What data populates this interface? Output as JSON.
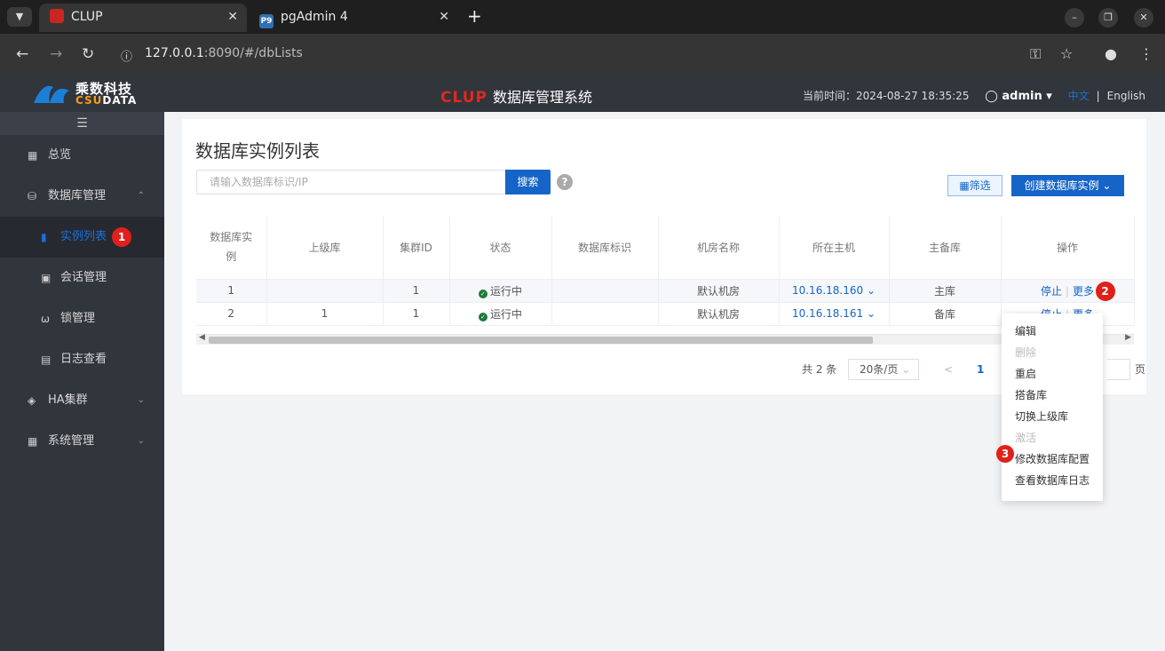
{
  "browser": {
    "tabs": [
      {
        "title": "CLUP",
        "active": true
      },
      {
        "title": "pgAdmin 4",
        "active": false
      }
    ],
    "url_host": "127.0.0.1",
    "url_rest": ":8090/#/dbLists",
    "pg_fav": "P9"
  },
  "header": {
    "logo_cn": "乘数科技",
    "logo_en_cs": "CSU",
    "logo_en_data": "DATA",
    "brand": "CLUP",
    "title": "数据库管理系统",
    "time": "当前时间：2024-08-27 18:35:25",
    "user": "admin",
    "lang_cn": "中文",
    "lang_sep": "|",
    "lang_en": "English"
  },
  "sidebar": {
    "items": [
      {
        "label": "总览"
      },
      {
        "label": "数据库管理"
      },
      {
        "label": "实例列表"
      },
      {
        "label": "会话管理"
      },
      {
        "label": "锁管理"
      },
      {
        "label": "日志查看"
      },
      {
        "label": "HA集群"
      },
      {
        "label": "系统管理"
      }
    ]
  },
  "main": {
    "title": "数据库实例列表",
    "search_placeholder": "请输入数据库标识/IP",
    "search_label": "搜索",
    "help": "?",
    "filter_label": "筛选",
    "create_label": "创建数据库实例",
    "columns": [
      "数据库实例",
      "上级库",
      "集群ID",
      "状态",
      "数据库标识",
      "机房名称",
      "所在主机",
      "主备库",
      "操作"
    ],
    "rows": [
      {
        "id": "1",
        "upper": "",
        "cluster": "1",
        "status": "运行中",
        "tag": "",
        "room": "默认机房",
        "host": "10.16.18.160",
        "role": "主库"
      },
      {
        "id": "2",
        "upper": "1",
        "cluster": "1",
        "status": "运行中",
        "tag": "",
        "room": "默认机房",
        "host": "10.16.18.161",
        "role": "备库"
      }
    ],
    "op_stop": "停止",
    "op_more": "更多",
    "total": "共 2 条",
    "page_size": "20条/页",
    "current_page": "1",
    "page_suffix": "页"
  },
  "dropdown": {
    "items": [
      {
        "label": "编辑",
        "disabled": false
      },
      {
        "label": "删除",
        "disabled": true
      },
      {
        "label": "重启",
        "disabled": false
      },
      {
        "label": "搭备库",
        "disabled": false
      },
      {
        "label": "切换上级库",
        "disabled": false
      },
      {
        "label": "激活",
        "disabled": true
      },
      {
        "label": "修改数据库配置",
        "disabled": false
      },
      {
        "label": "查看数据库日志",
        "disabled": false
      }
    ]
  },
  "annotations": [
    "1",
    "2",
    "3"
  ],
  "colors": {
    "accent": "#1565c8",
    "badge": "#e0201a",
    "sidebar": "#31353c"
  }
}
